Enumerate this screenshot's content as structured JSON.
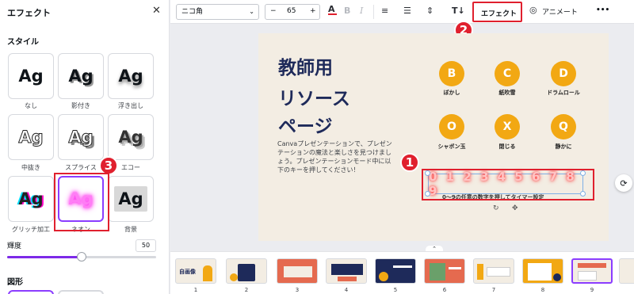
{
  "left_panel": {
    "title": "エフェクト",
    "style_section": "スタイル",
    "effects": [
      {
        "label": "なし",
        "sample": "Ag"
      },
      {
        "label": "影付き",
        "sample": "Ag"
      },
      {
        "label": "浮き出し",
        "sample": "Ag"
      },
      {
        "label": "中抜き",
        "sample": "Ag"
      },
      {
        "label": "スプライス",
        "sample": "Ag"
      },
      {
        "label": "エコー",
        "sample": "Ag"
      },
      {
        "label": "グリッチ加工",
        "sample": "Ag"
      },
      {
        "label": "ネオン",
        "sample": "Ag",
        "selected": true
      },
      {
        "label": "背景",
        "sample": "Ag"
      }
    ],
    "brightness_label": "輝度",
    "brightness_value": "50",
    "brightness_fraction": 0.5,
    "shape_section": "図形"
  },
  "toolbar": {
    "font": "ニコ角",
    "minus": "−",
    "size": "65",
    "plus": "+",
    "effect_button": "エフェクト",
    "animate_button": "アニメート",
    "more": "•••"
  },
  "slide": {
    "title_lines": [
      "教師用",
      "リソース",
      "ページ"
    ],
    "body": "Canvaプレゼンテーションで、プレゼンテーションの魔法と楽しさを見つけましょう。プレゼンテーションモード中に以下のキーを押してください！",
    "keys": [
      {
        "letter": "B",
        "label": "ぼかし"
      },
      {
        "letter": "C",
        "label": "紙吹雪"
      },
      {
        "letter": "D",
        "label": "ドラムロール"
      },
      {
        "letter": "O",
        "label": "シャボン玉"
      },
      {
        "letter": "X",
        "label": "閉じる"
      },
      {
        "letter": "Q",
        "label": "静かに"
      }
    ],
    "neon_digits": "0 1 2 3 4 5 6 7 8 9",
    "neon_caption": "0～9の任意の数字を押してタイマー設定"
  },
  "annotations": {
    "badge1": "1",
    "badge2": "2",
    "badge3": "3"
  },
  "filmstrip": {
    "pages": [
      "1",
      "2",
      "3",
      "4",
      "5",
      "6",
      "7",
      "8",
      "9"
    ],
    "first_thumb_title": "自画像"
  },
  "colors": {
    "accent": "#8b3dff",
    "annotation_red": "#e0202e",
    "key_orange": "#f2a813",
    "slide_bg": "#f3ede3",
    "title_navy": "#1e2a5a"
  }
}
